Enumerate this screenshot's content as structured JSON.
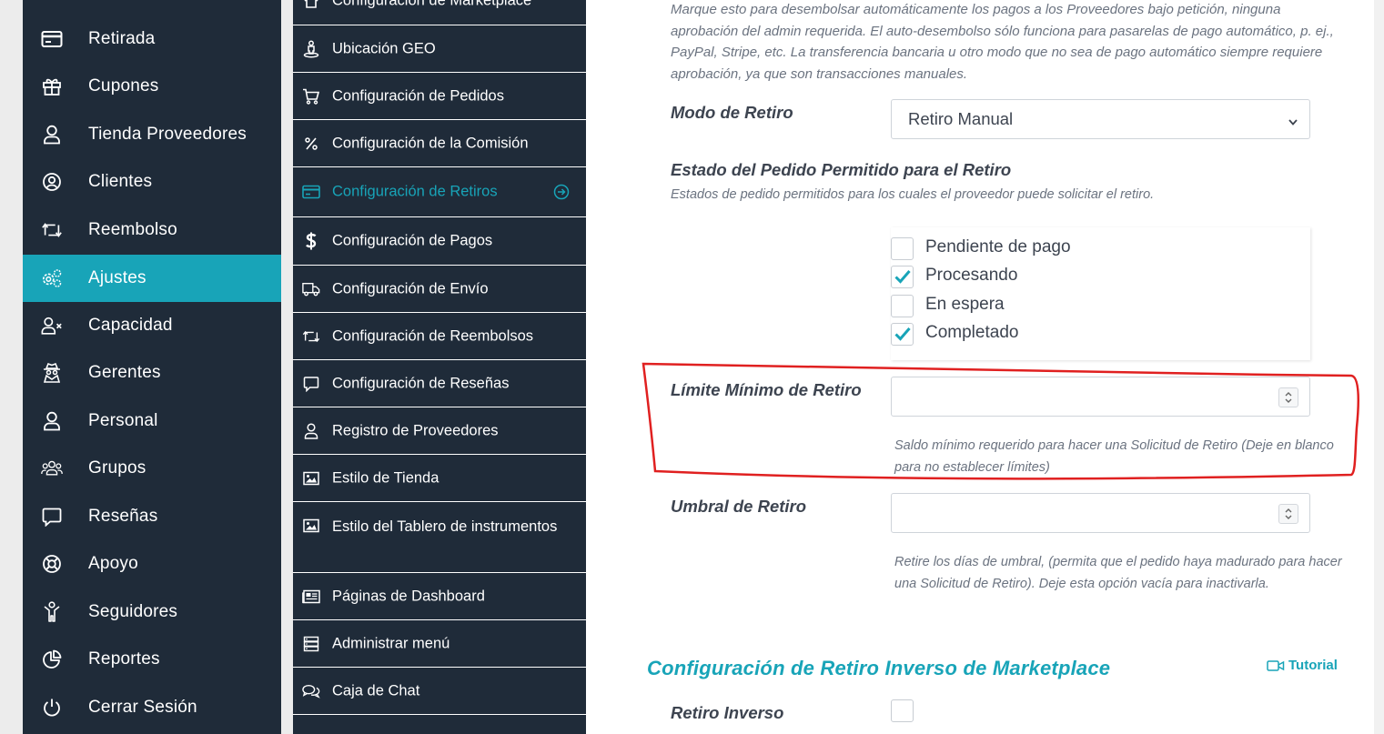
{
  "sidebar": {
    "items": [
      {
        "label": "Retirada",
        "icon": "credit-card-icon"
      },
      {
        "label": "Cupones",
        "icon": "gift-icon"
      },
      {
        "label": "Tienda Proveedores",
        "icon": "user-icon"
      },
      {
        "label": "Clientes",
        "icon": "user-circle-icon"
      },
      {
        "label": "Reembolso",
        "icon": "retweet-icon"
      },
      {
        "label": "Ajustes",
        "icon": "cogs-icon",
        "active": true
      },
      {
        "label": "Capacidad",
        "icon": "user-times-icon"
      },
      {
        "label": "Gerentes",
        "icon": "user-secret-icon"
      },
      {
        "label": "Personal",
        "icon": "user-icon"
      },
      {
        "label": "Grupos",
        "icon": "users-icon"
      },
      {
        "label": "Reseñas",
        "icon": "comment-icon"
      },
      {
        "label": "Apoyo",
        "icon": "life-ring-icon"
      },
      {
        "label": "Seguidores",
        "icon": "child-icon"
      },
      {
        "label": "Reportes",
        "icon": "pie-chart-icon"
      },
      {
        "label": "Cerrar Sesión",
        "icon": "power-icon"
      }
    ]
  },
  "submenu": {
    "items": [
      {
        "label": "Configuración de Marketplace",
        "icon": "home-icon"
      },
      {
        "label": "Ubicación GEO",
        "icon": "street-view-icon"
      },
      {
        "label": "Configuración de Pedidos",
        "icon": "cart-icon"
      },
      {
        "label": "Configuración de la Comisión",
        "icon": "percent-icon"
      },
      {
        "label": "Configuración de Retiros",
        "icon": "credit-card-icon",
        "active": true
      },
      {
        "label": "Configuración de Pagos",
        "icon": "dollar-icon"
      },
      {
        "label": "Configuración de Envío",
        "icon": "truck-icon"
      },
      {
        "label": "Configuración de Reembolsos",
        "icon": "retweet-icon"
      },
      {
        "label": "Configuración de Reseñas",
        "icon": "comment-icon"
      },
      {
        "label": "Registro de Proveedores",
        "icon": "user-icon"
      },
      {
        "label": "Estilo de Tienda",
        "icon": "image-icon"
      },
      {
        "label": "Estilo del Tablero de instrumentos",
        "icon": "image-icon"
      },
      {
        "label": "Páginas de Dashboard",
        "icon": "newspaper-icon"
      },
      {
        "label": "Administrar menú",
        "icon": "server-icon"
      },
      {
        "label": "Caja de Chat",
        "icon": "comments-icon"
      }
    ]
  },
  "content": {
    "auto_disburse_note": "Marque esto para desembolsar automáticamente los pagos a los Proveedores bajo petición, ninguna aprobación del admin requerida. El auto-desembolso sólo funciona para pasarelas de pago automático, p. ej., PayPal, Stripe, etc. La transferencia bancaria u otro modo que no sea de pago automático siempre requiere aprobación, ya que son transacciones manuales.",
    "withdrawal_mode": {
      "label": "Modo de Retiro",
      "value": "Retiro Manual"
    },
    "order_status": {
      "label": "Estado del Pedido Permitido para el Retiro",
      "description": "Estados de pedido permitidos para los cuales el proveedor puede solicitar el retiro.",
      "options": [
        {
          "label": "Pendiente de pago",
          "checked": false
        },
        {
          "label": "Procesando",
          "checked": true
        },
        {
          "label": "En espera",
          "checked": false
        },
        {
          "label": "Completado",
          "checked": true
        }
      ]
    },
    "min_limit": {
      "label": "Límite Mínimo de Retiro",
      "value": "",
      "help": "Saldo mínimo requerido para hacer una Solicitud de Retiro (Deje en blanco para no establecer límites)"
    },
    "threshold": {
      "label": "Umbral de Retiro",
      "value": "",
      "help": "Retire los días de umbral, (permita que el pedido haya madurado para hacer una Solicitud de Retiro). Deje esta opción vacía para inactivarla."
    },
    "reverse_section": {
      "title": "Configuración de Retiro Inverso de Marketplace",
      "tutorial_label": "Tutorial",
      "reverse_label": "Retiro Inverso",
      "reverse_checked": false
    }
  },
  "colors": {
    "sidebar_bg": "#1f2b39",
    "accent": "#18a4b8",
    "annotation": "#e02020"
  }
}
